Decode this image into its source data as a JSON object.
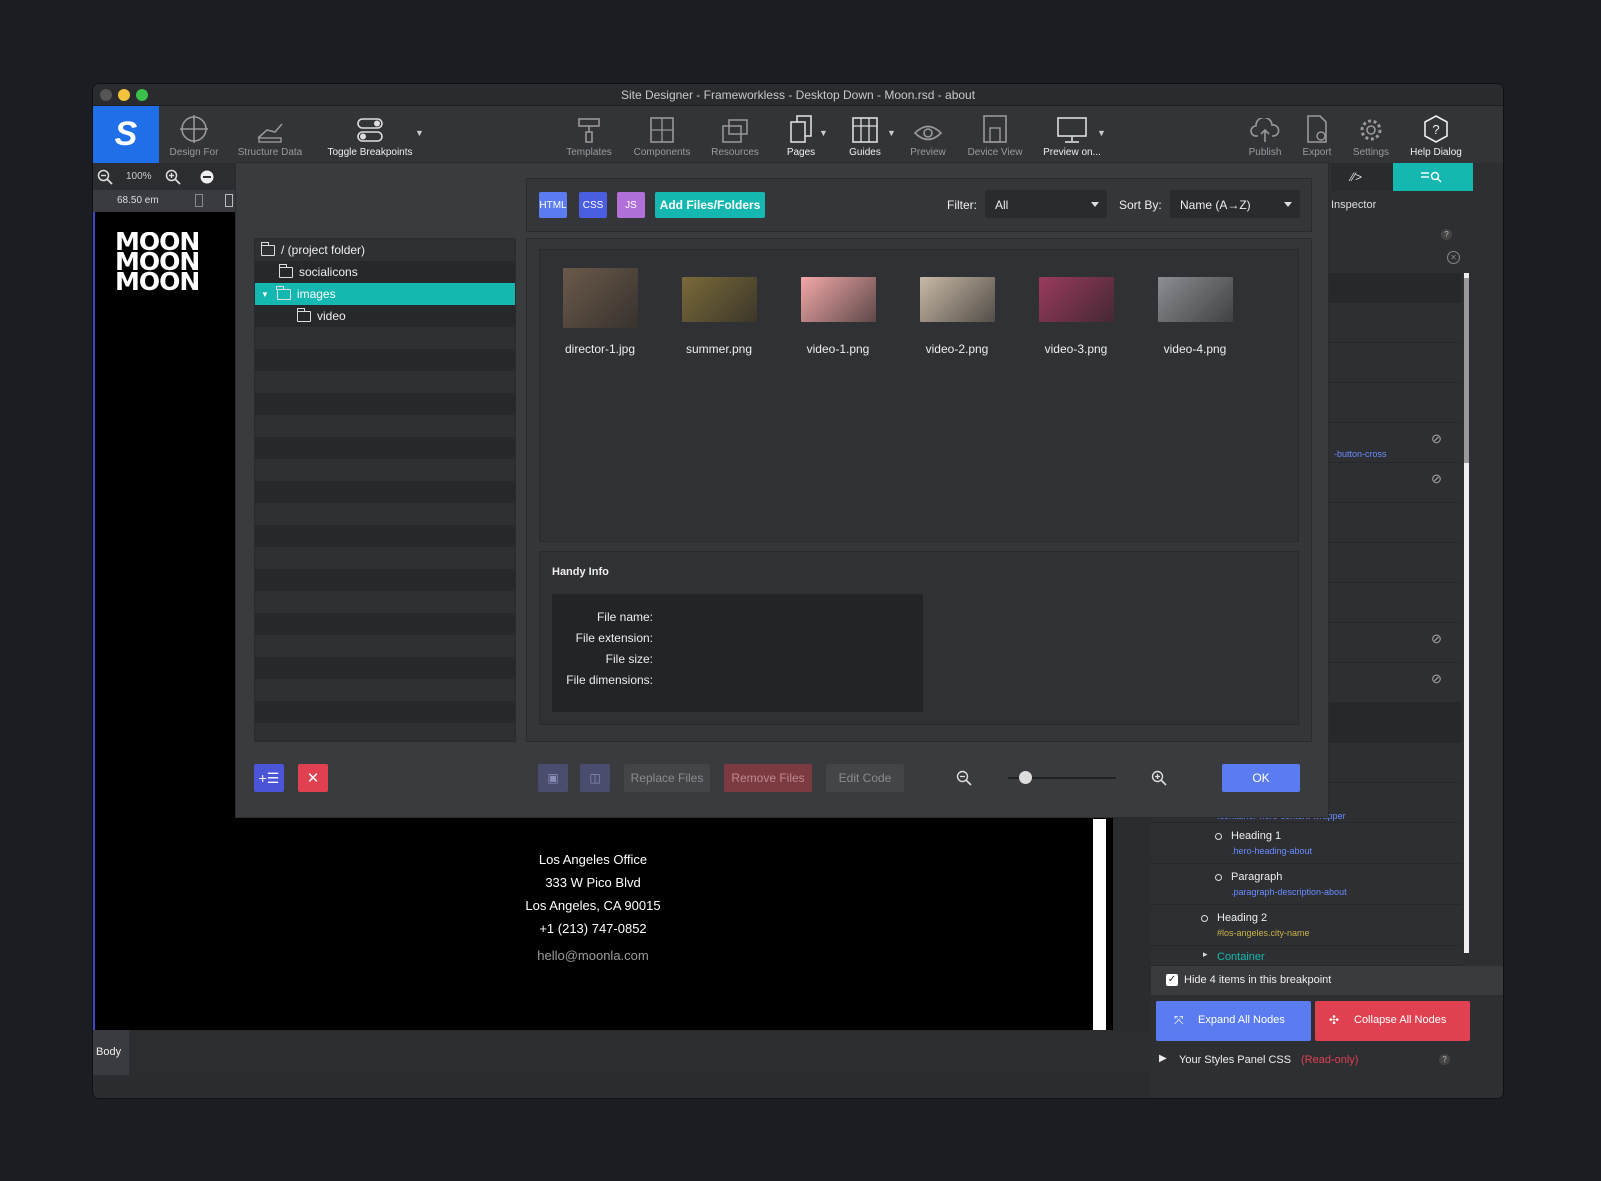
{
  "window": {
    "title": "Site Designer - Frameworkless - Desktop Down - Moon.rsd - about"
  },
  "toolbar": {
    "logo": "S",
    "items": [
      {
        "label": "Design For"
      },
      {
        "label": "Structure Data"
      },
      {
        "label": "Toggle Breakpoints"
      },
      {
        "label": "Templates"
      },
      {
        "label": "Components"
      },
      {
        "label": "Resources"
      },
      {
        "label": "Pages"
      },
      {
        "label": "Guides"
      },
      {
        "label": "Preview"
      },
      {
        "label": "Device View"
      },
      {
        "label": "Preview on..."
      },
      {
        "label": "Publish"
      },
      {
        "label": "Export"
      },
      {
        "label": "Settings"
      },
      {
        "label": "Help Dialog"
      }
    ]
  },
  "canvas": {
    "zoom": "100%",
    "width": "68.50 em",
    "logo_lines": [
      "MOON",
      "MOON",
      "MOON"
    ],
    "office": {
      "title": "Los Angeles Office",
      "street": "333 W Pico Blvd",
      "city": "Los Angeles, CA 90015",
      "phone": "+1 (213) 747-0852",
      "email": "hello@moonla.com"
    },
    "footer_tag": "Body"
  },
  "right_panel": {
    "tab_code": "⁄⁄>",
    "inspector_label": "Inspector",
    "help": "?",
    "partial_class_1": "-button-cross",
    "wrapper_class": ".container-hero-content-wrapper",
    "nodes": [
      {
        "name": "Heading 1",
        "class": ".hero-heading-about"
      },
      {
        "name": "Paragraph",
        "class": ".paragraph-description-about"
      },
      {
        "name": "Heading 2",
        "class": "#los-angeles.city-name"
      },
      {
        "name": "Container",
        "class": ""
      }
    ],
    "hide_items_label": "Hide 4 items in this breakpoint",
    "expand_label": "Expand All Nodes",
    "collapse_label": "Collapse All Nodes",
    "styles_label": "Your Styles Panel CSS",
    "styles_readonly": "(Read-only)"
  },
  "dialog": {
    "tags": {
      "html": "HTML",
      "css": "CSS",
      "js": "JS"
    },
    "add_button": "Add Files/Folders",
    "filter_label": "Filter:",
    "filter_value": "All",
    "sort_label": "Sort By:",
    "sort_value": "Name (A→Z)",
    "tree": [
      {
        "label": "/ (project folder)"
      },
      {
        "label": "socialicons"
      },
      {
        "label": "images"
      },
      {
        "label": "video"
      }
    ],
    "files": [
      {
        "name": "director-1.jpg",
        "color": "#6b5a4a"
      },
      {
        "name": "summer.png",
        "color": "#7a6a3a"
      },
      {
        "name": "video-1.png",
        "color": "#f2a8a8"
      },
      {
        "name": "video-2.png",
        "color": "#c9b9a6"
      },
      {
        "name": "video-3.png",
        "color": "#9a3a5e"
      },
      {
        "name": "video-4.png",
        "color": "#8a8e92"
      }
    ],
    "handy_info": {
      "title": "Handy Info",
      "file_name": "File name:",
      "file_extension": "File extension:",
      "file_size": "File size:",
      "file_dimensions": "File dimensions:"
    },
    "bottom": {
      "replace": "Replace Files",
      "remove": "Remove Files",
      "edit_code": "Edit Code",
      "ok": "OK",
      "zoom_level": 0.12
    }
  },
  "colors": {
    "accent": "#14b8b0",
    "blue": "#5a7cf0",
    "red": "#e04050",
    "logo_bg": "#1f6fe8"
  }
}
